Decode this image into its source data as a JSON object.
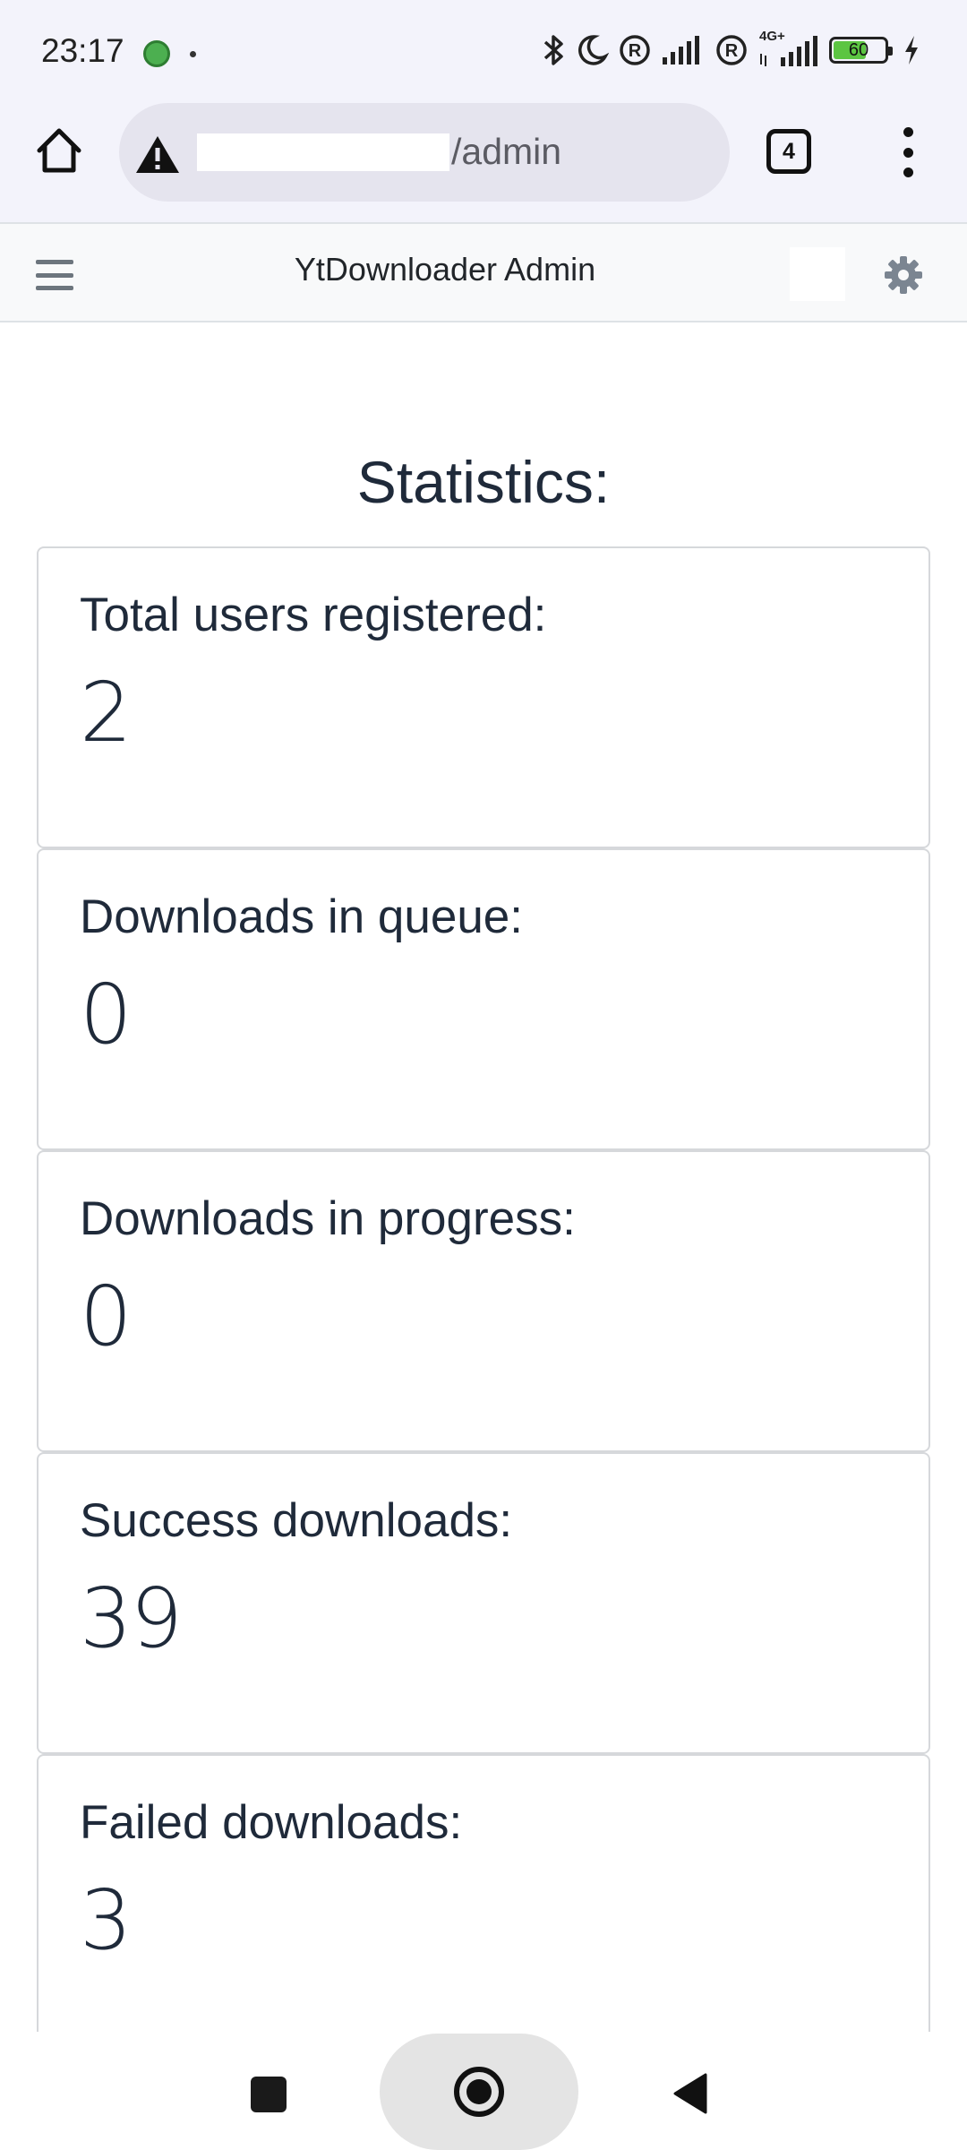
{
  "status_bar": {
    "time": "23:17",
    "network_label": "4G+",
    "battery_level": "60",
    "icons": [
      "bluetooth-icon",
      "moon-icon",
      "registered-icon",
      "signal-icon",
      "registered-icon",
      "signal-4g-icon",
      "battery-icon",
      "charging-icon"
    ]
  },
  "browser": {
    "url_path": "/admin",
    "tab_count": "4",
    "icons": [
      "home-icon",
      "warning-icon",
      "tabs-icon",
      "more-vert-icon"
    ]
  },
  "header": {
    "title": "YtDownloader Admin",
    "icons": [
      "hamburger-icon",
      "gear-icon"
    ]
  },
  "main": {
    "title": "Statistics:",
    "stats": [
      {
        "label": "Total users registered:",
        "value": "2"
      },
      {
        "label": "Downloads in queue:",
        "value": "0"
      },
      {
        "label": "Downloads in progress:",
        "value": "0"
      },
      {
        "label": "Success downloads:",
        "value": "39"
      },
      {
        "label": "Failed downloads:",
        "value": "3"
      }
    ]
  },
  "colors": {
    "status_bg": "#f3f3fb",
    "header_bg": "#f8f9fa",
    "text": "#1f2a3a",
    "border": "#d6d8db",
    "battery": "#5cc542"
  },
  "nav": {
    "icons": [
      "recents-icon",
      "home-icon",
      "back-icon"
    ]
  }
}
